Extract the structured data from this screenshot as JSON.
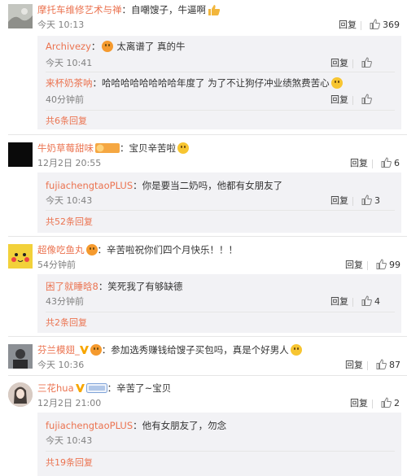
{
  "comments": [
    {
      "user": "摩托车维修艺术与禅",
      "text": "自嘲馊子，牛逼啊",
      "time": "今天 10:13",
      "reply_label": "回复",
      "likes": "369",
      "avatar_color": "#b6b8b3",
      "replies": [
        {
          "user": "Archivezy",
          "text": "太离谱了 真的牛",
          "time": "今天 10:41",
          "reply_label": "回复"
        },
        {
          "user": "来杯奶茶呐",
          "text": "哈哈哈哈哈哈哈哈年度了 为了不让狗仔冲业绩煞费苦心",
          "time": "40分钟前",
          "reply_label": "回复"
        }
      ],
      "more": "共6条回复"
    },
    {
      "user": "牛奶草莓甜味",
      "badge": "铁粉",
      "text": "宝贝辛苦啦",
      "time": "12月2日 20:55",
      "reply_label": "回复",
      "likes": "6",
      "avatar_color": "#0a0a0a",
      "replies": [
        {
          "user": "fujiachengtaoPLUS",
          "text": "你是要当二奶吗，他都有女朋友了",
          "time": "今天 10:43",
          "reply_label": "回复",
          "likes": "3"
        }
      ],
      "more": "共52条回复"
    },
    {
      "user": "超像吃鱼丸",
      "text": "辛苦啦祝你们四个月快乐！！！",
      "time": "54分钟前",
      "reply_label": "回复",
      "likes": "99",
      "avatar_color": "#f4d535",
      "replies": [
        {
          "user": "困了就睡晗8",
          "text": "笑死我了有够缺德",
          "time": "43分钟前",
          "reply_label": "回复",
          "likes": "4"
        }
      ],
      "more": "共2条回复"
    },
    {
      "user": "芬兰模翅_",
      "text": "参加选秀赚钱给馊子买包吗，真是个好男人",
      "time": "今天 10:36",
      "reply_label": "回复",
      "likes": "87",
      "avatar_color": "#7a7e84"
    },
    {
      "user": "三花hua",
      "badge": "铁粉",
      "text": "辛苦了~宝贝",
      "time": "12月2日 21:00",
      "reply_label": "回复",
      "likes": "2",
      "avatar_color": "#c9b7ad",
      "replies": [
        {
          "user": "fujiachengtaoPLUS",
          "text": "他有女朋友了，勿念",
          "time": "今天 10:43",
          "reply_label": "回复"
        }
      ],
      "more": "共19条回复"
    }
  ],
  "colors": {
    "username": "#eb7350",
    "sub_bg": "#f2f2f5",
    "meta": "#808080"
  }
}
